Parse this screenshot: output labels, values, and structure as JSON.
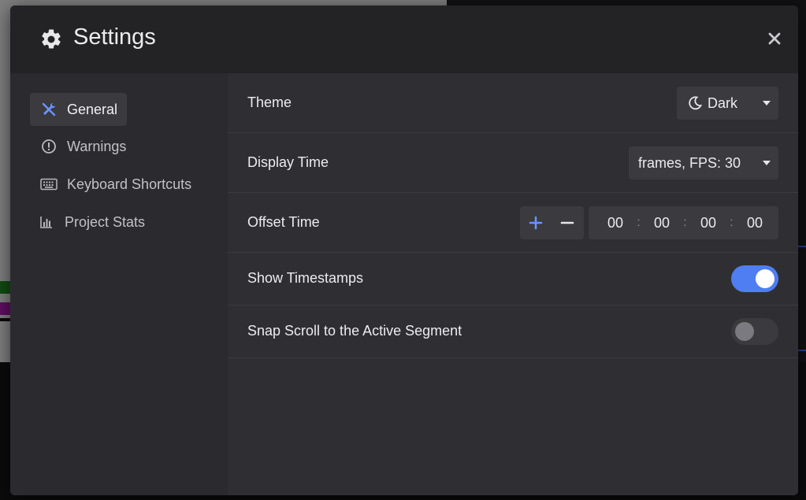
{
  "modal": {
    "title": "Settings",
    "close_icon": "close-icon",
    "title_icon": "gear-icon"
  },
  "sidebar": {
    "items": [
      {
        "label": "General",
        "icon": "tools-icon",
        "active": true
      },
      {
        "label": "Warnings",
        "icon": "warning-circle-icon",
        "active": false
      },
      {
        "label": "Keyboard Shortcuts",
        "icon": "keyboard-icon",
        "active": false
      },
      {
        "label": "Project Stats",
        "icon": "bar-chart-icon",
        "active": false
      }
    ]
  },
  "settings": {
    "theme": {
      "label": "Theme",
      "value": "Dark",
      "icon": "moon-icon"
    },
    "display_time": {
      "label": "Display Time",
      "value": "frames, FPS: 30"
    },
    "offset_time": {
      "label": "Offset Time",
      "segments": [
        "00",
        "00",
        "00",
        "00"
      ],
      "separator": ":"
    },
    "show_timestamps": {
      "label": "Show Timestamps",
      "enabled": true
    },
    "snap_scroll": {
      "label": "Snap Scroll to the Active Segment",
      "enabled": false
    }
  },
  "colors": {
    "accent": "#4f7df2",
    "modal_bg": "#2b2b2f",
    "header_bg": "#232326"
  }
}
